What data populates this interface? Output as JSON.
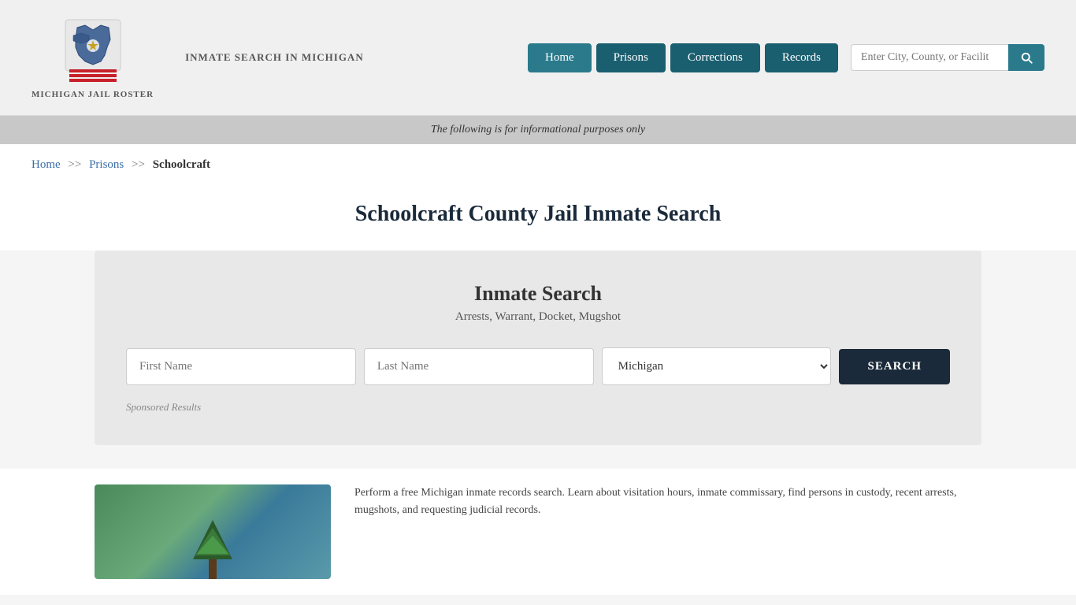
{
  "header": {
    "logo_text": "MICHIGAN\nJAIL ROSTER",
    "site_title": "INMATE SEARCH IN\nMICHIGAN",
    "nav": {
      "home_label": "Home",
      "prisons_label": "Prisons",
      "corrections_label": "Corrections",
      "records_label": "Records"
    },
    "search_placeholder": "Enter City, County, or Facilit"
  },
  "info_banner": {
    "text": "The following is for informational purposes only"
  },
  "breadcrumb": {
    "home": "Home",
    "sep1": ">>",
    "prisons": "Prisons",
    "sep2": ">>",
    "current": "Schoolcraft"
  },
  "page_title": "Schoolcraft County Jail Inmate Search",
  "search_card": {
    "title": "Inmate Search",
    "subtitle": "Arrests, Warrant, Docket, Mugshot",
    "first_name_placeholder": "First Name",
    "last_name_placeholder": "Last Name",
    "state_default": "Michigan",
    "search_button": "SEARCH",
    "sponsored_label": "Sponsored Results"
  },
  "bottom_text": "Perform a free Michigan inmate records search. Learn about visitation hours, inmate commissary, find persons in custody, recent arrests, mugshots, and requesting judicial records."
}
